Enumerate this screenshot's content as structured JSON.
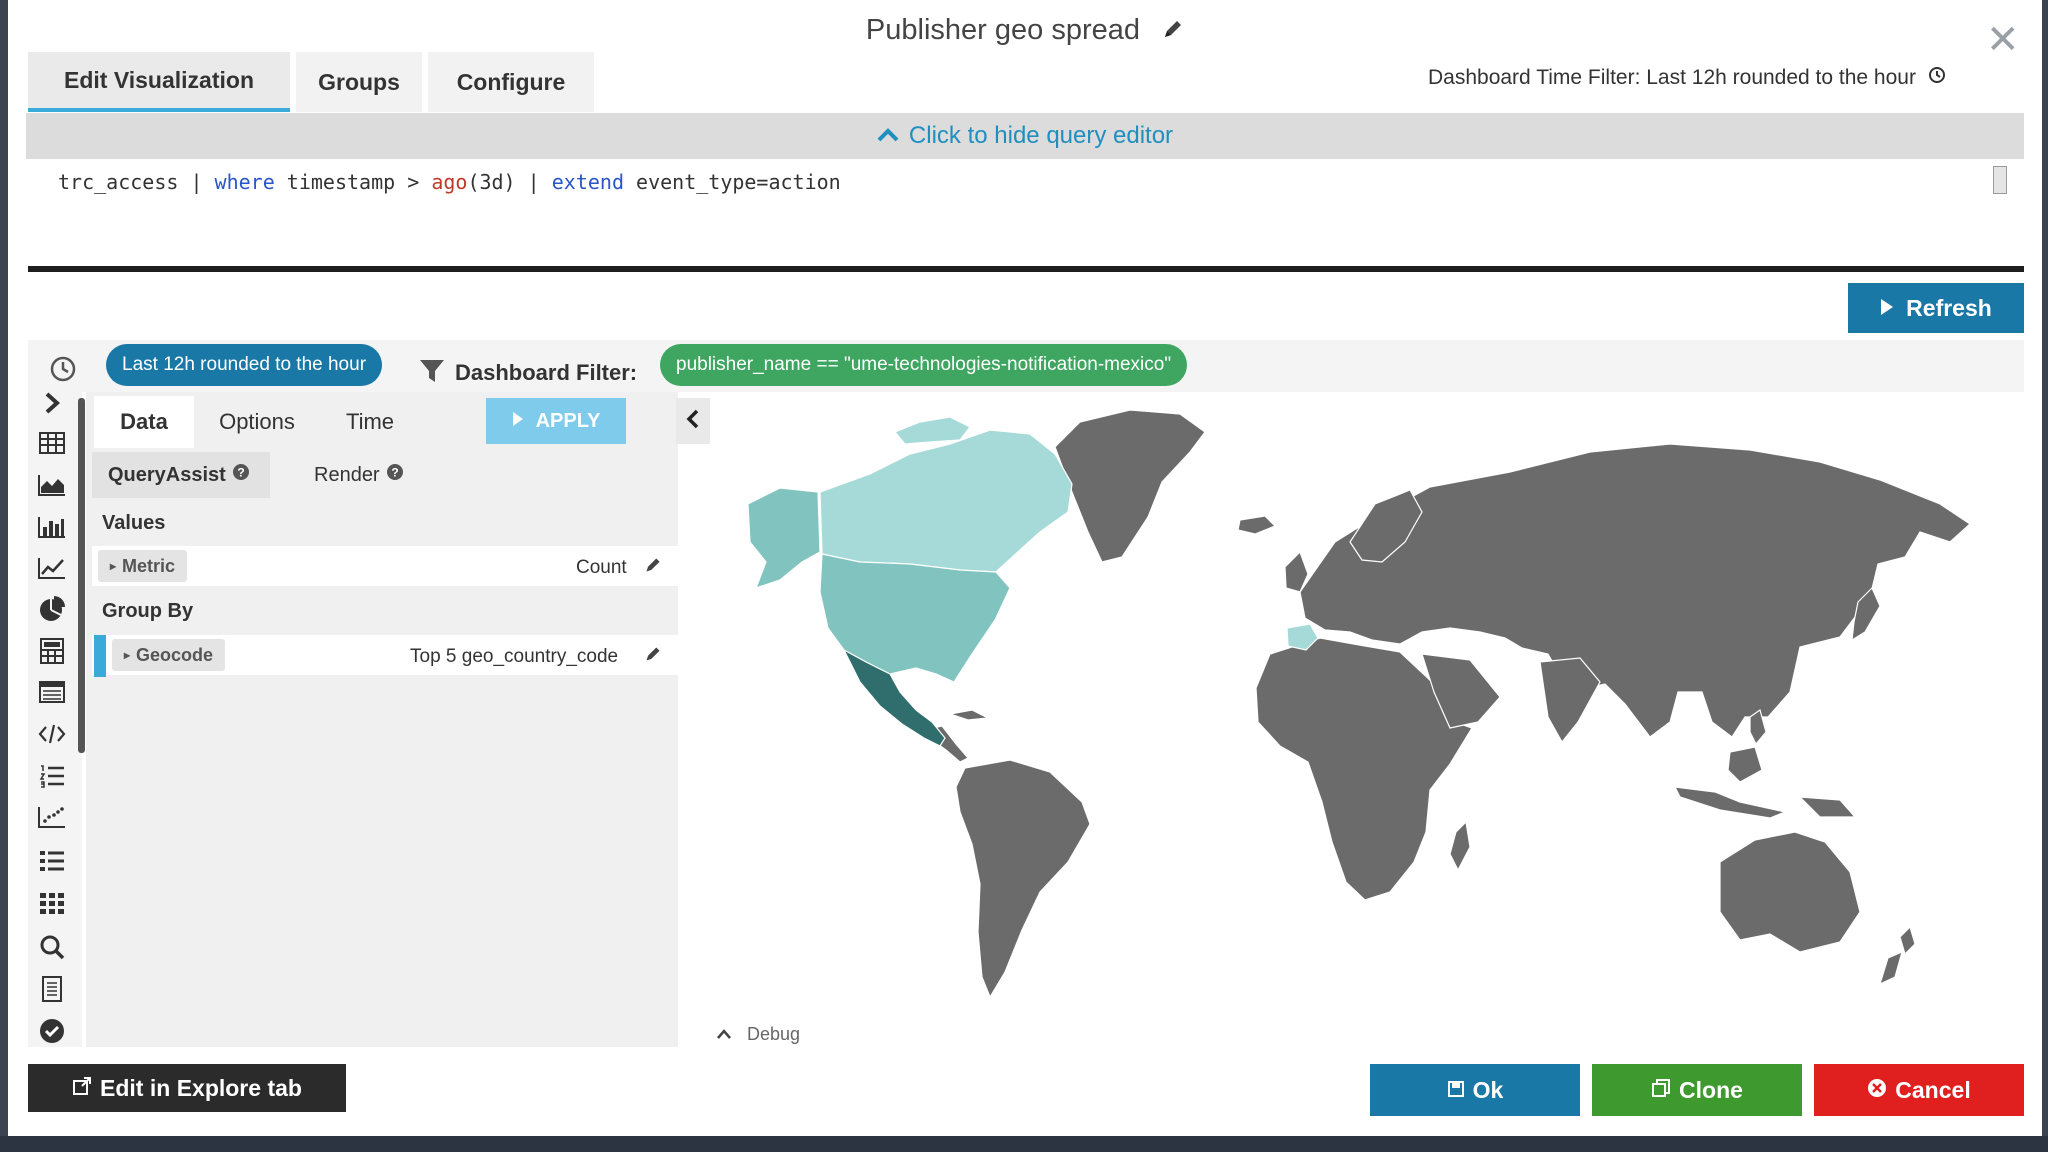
{
  "header": {
    "title": "Publisher geo spread",
    "time_filter_text": "Dashboard Time Filter: Last 12h rounded to the hour"
  },
  "top_tabs": [
    {
      "label": "Edit Visualization",
      "active": true
    },
    {
      "label": "Groups",
      "active": false
    },
    {
      "label": "Configure",
      "active": false
    }
  ],
  "query_editor": {
    "toggle_label": "Click to hide query editor",
    "query": {
      "t1": "trc_access | ",
      "k1": "where",
      "t2": " timestamp > ",
      "f1": "ago",
      "t3": "(3d) | ",
      "k2": "extend",
      "t4": " event_type=action"
    }
  },
  "refresh_label": "Refresh",
  "filters": {
    "time_pill": "Last 12h rounded to the hour",
    "dashboard_filter_label": "Dashboard Filter:",
    "dashboard_filter_value": "publisher_name == \"ume-technologies-notification-mexico\""
  },
  "rail_icons": [
    "chevron-right-icon",
    "table-icon",
    "area-chart-icon",
    "bar-chart-icon",
    "line-chart-icon",
    "pie-chart-icon",
    "calculator-icon",
    "list-view-icon",
    "code-icon",
    "numbered-list-icon",
    "scatter-icon",
    "bullet-list-icon",
    "grid-icon",
    "search-icon",
    "document-icon",
    "check-circle-icon"
  ],
  "panel": {
    "tabs": [
      {
        "label": "Data",
        "active": true
      },
      {
        "label": "Options",
        "active": false
      },
      {
        "label": "Time",
        "active": false
      }
    ],
    "apply_label": "APPLY",
    "subtabs": {
      "query_assist": "QueryAssist",
      "render": "Render"
    },
    "values_label": "Values",
    "metric": {
      "chip": "Metric",
      "value": "Count"
    },
    "group_by_label": "Group By",
    "geocode": {
      "chip": "Geocode",
      "value": "Top 5 geo_country_code"
    }
  },
  "map": {
    "colors": {
      "default": "#6b6b6b",
      "light": "#a6dad8",
      "medium": "#80c3bf",
      "dark": "#2f6e6c"
    },
    "highlighted_regions": [
      "Mexico",
      "United States",
      "Canada",
      "Alaska",
      "Spain"
    ]
  },
  "debug_label": "Debug",
  "footer": {
    "explore_label": "Edit in Explore tab",
    "ok_label": "Ok",
    "clone_label": "Clone",
    "cancel_label": "Cancel"
  },
  "colors": {
    "accent": "#1a78a7",
    "success": "#3e9a2e",
    "danger": "#e0201e",
    "pill_green": "#3ea660"
  }
}
